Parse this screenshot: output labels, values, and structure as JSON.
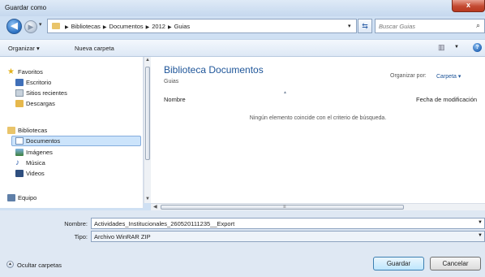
{
  "window": {
    "title": "Guardar como",
    "close_glyph": "x"
  },
  "address": {
    "breadcrumbs": [
      "Bibliotecas",
      "Documentos",
      "2012",
      "Guias"
    ],
    "search_placeholder": "Buscar Guias"
  },
  "toolbar": {
    "organize_label": "Organizar ▾",
    "new_folder_label": "Nueva carpeta",
    "help_glyph": "?"
  },
  "sidebar": {
    "favorites": {
      "label": "Favoritos",
      "icon": "star-icon"
    },
    "favorites_items": [
      {
        "label": "Escritorio",
        "icon": "desktop-icon"
      },
      {
        "label": "Sitios recientes",
        "icon": "recent-places-icon"
      },
      {
        "label": "Descargas",
        "icon": "downloads-icon"
      }
    ],
    "libraries": {
      "label": "Bibliotecas",
      "icon": "libraries-icon"
    },
    "library_items": [
      {
        "label": "Documentos",
        "icon": "documents-icon",
        "selected": true
      },
      {
        "label": "Imágenes",
        "icon": "pictures-icon"
      },
      {
        "label": "Música",
        "icon": "music-icon"
      },
      {
        "label": "Videos",
        "icon": "videos-icon"
      }
    ],
    "computer": {
      "label": "Equipo",
      "icon": "computer-icon"
    }
  },
  "content": {
    "library_title": "Biblioteca Documentos",
    "library_subtitle": "Guias",
    "arrange_label": "Organizar por:",
    "arrange_value": "Carpeta ▾",
    "columns": {
      "name": "Nombre",
      "date": "Fecha de modificación"
    },
    "empty_message": "Ningún elemento coincide con el criterio de búsqueda."
  },
  "form": {
    "filename_label": "Nombre:",
    "filename_value": "Actividades_Institucionales_260520111235__Export",
    "type_label": "Tipo:",
    "type_value": "Archivo WinRAR ZIP"
  },
  "footer": {
    "hide_folders_label": "Ocultar carpetas",
    "save_label": "Guardar",
    "cancel_label": "Cancelar"
  },
  "colors": {
    "link": "#1e5599",
    "selection": "#cce4fb",
    "close": "#c44a32"
  }
}
